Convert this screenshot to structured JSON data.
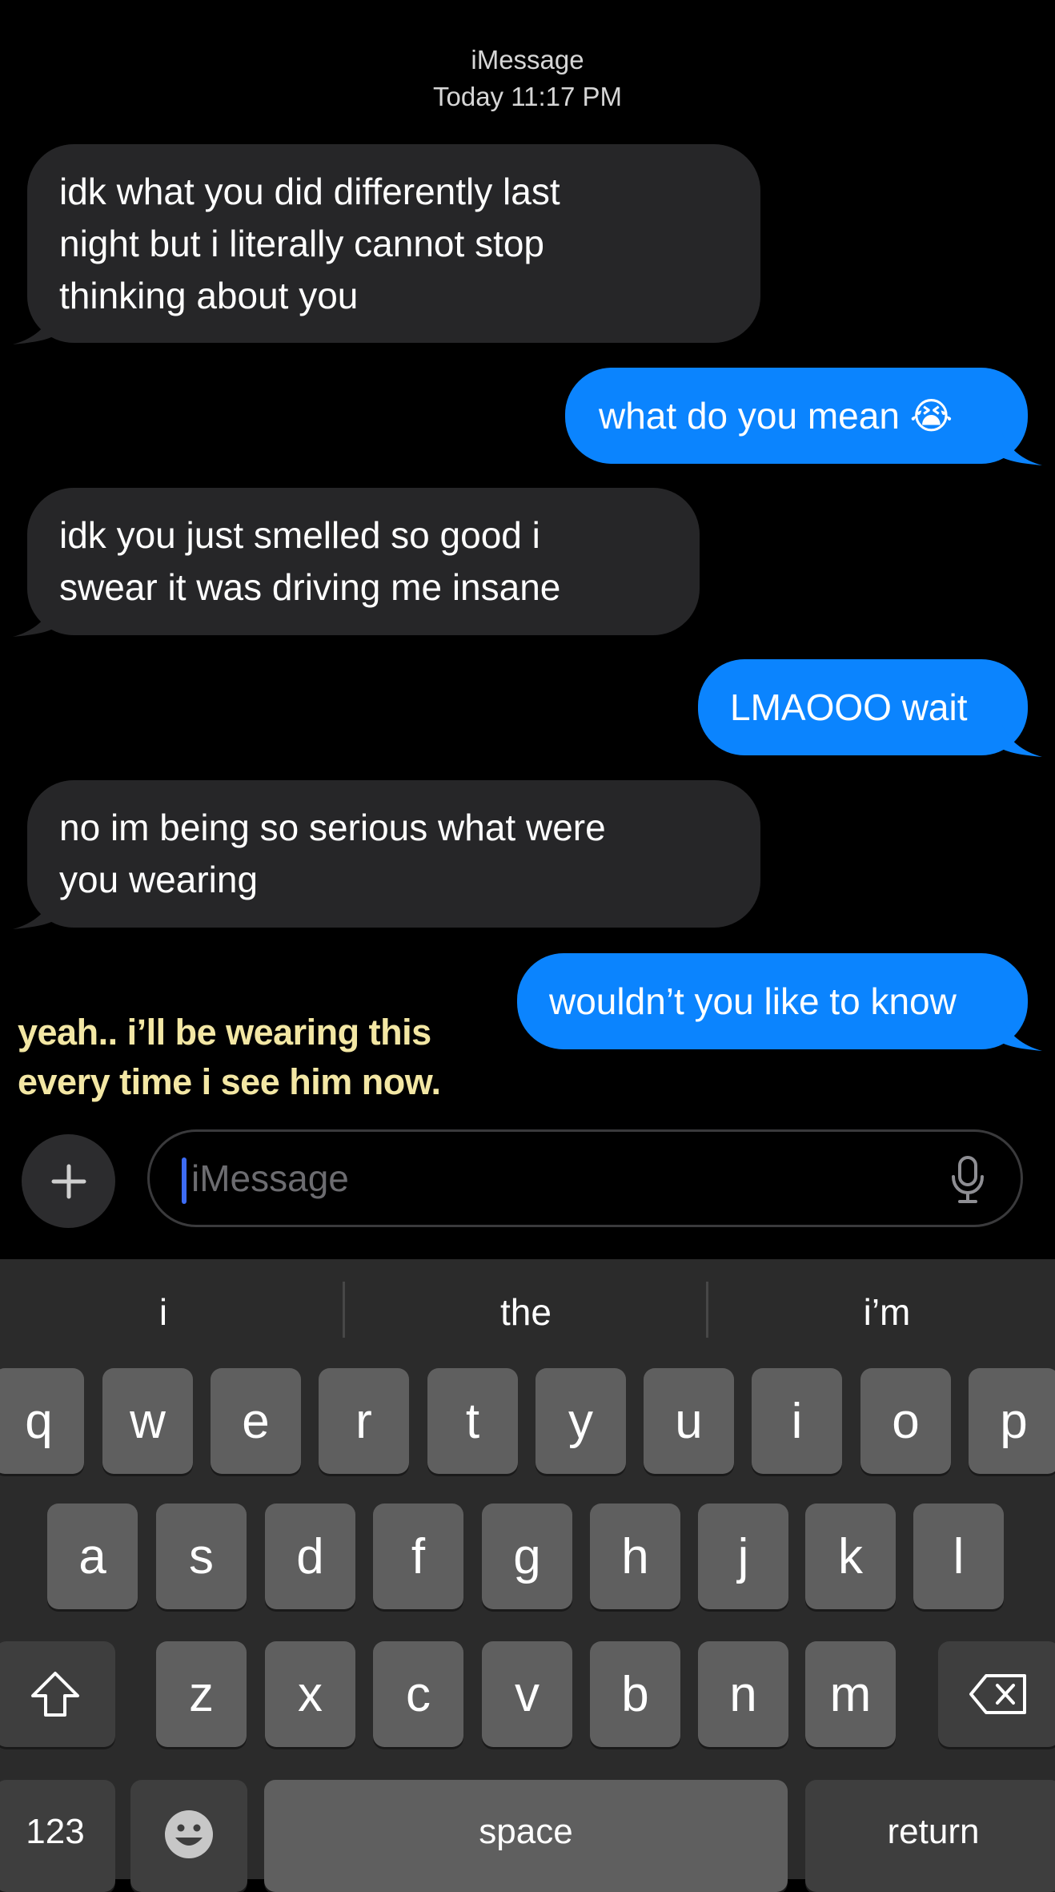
{
  "header": {
    "service": "iMessage",
    "timestamp": "Today 11:17 PM"
  },
  "messages": [
    {
      "direction": "incoming",
      "text": "idk what you did differently last\nnight but i literally cannot stop\nthinking about you"
    },
    {
      "direction": "outgoing",
      "text": "what do you mean 😭"
    },
    {
      "direction": "incoming",
      "text": "idk you just smelled so good i\nswear it was driving me insane"
    },
    {
      "direction": "outgoing",
      "text": "LMAOOO wait"
    },
    {
      "direction": "incoming",
      "text": "no im being so serious what were\nyou wearing"
    },
    {
      "direction": "outgoing",
      "text": "wouldn’t you like to know"
    }
  ],
  "caption": "yeah.. i’ll be wearing this\nevery time i see him now.",
  "composer": {
    "placeholder": "iMessage",
    "plus_icon": "plus-icon",
    "mic_icon": "microphone-icon"
  },
  "keyboard": {
    "suggestions": [
      "i",
      "the",
      "i’m"
    ],
    "row1": [
      "q",
      "w",
      "e",
      "r",
      "t",
      "y",
      "u",
      "i",
      "o",
      "p"
    ],
    "row2": [
      "a",
      "s",
      "d",
      "f",
      "g",
      "h",
      "j",
      "k",
      "l"
    ],
    "row3": [
      "z",
      "x",
      "c",
      "v",
      "b",
      "n",
      "m"
    ],
    "numbers_label": "123",
    "space_label": "space",
    "return_label": "return",
    "shift_icon": "shift-icon",
    "delete_icon": "backspace-icon",
    "emoji_icon": "emoji-icon"
  },
  "colors": {
    "incoming_bubble": "#262628",
    "outgoing_bubble": "#0b84fe",
    "caption_text": "#f3e7a4",
    "keyboard_bg": "#2b2b2b",
    "key_bg": "#5f5f5f"
  }
}
